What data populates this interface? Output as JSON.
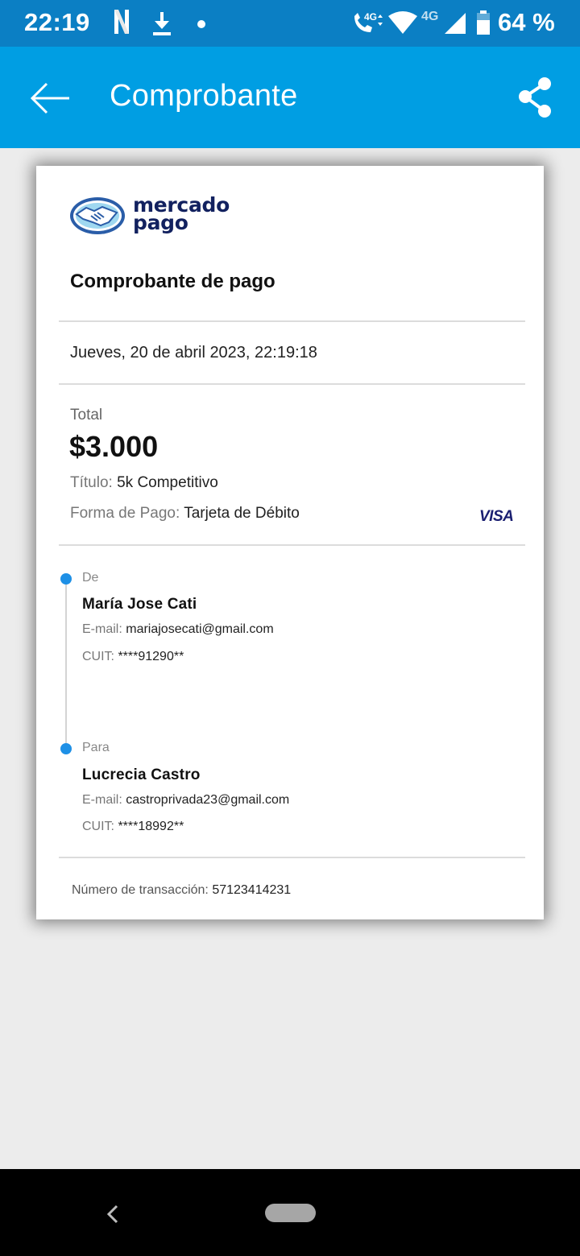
{
  "status_bar": {
    "time": "22:19",
    "network_badge": "4G",
    "battery_percent": "64 %",
    "icons": [
      "netflix-n-icon",
      "download-icon",
      "notification-dot-icon",
      "volte-call-icon",
      "wifi-icon",
      "signal-icon",
      "battery-icon"
    ]
  },
  "app_bar": {
    "title": "Comprobante",
    "icons": [
      "back-arrow-icon",
      "share-icon"
    ],
    "color": "#009ee3"
  },
  "receipt": {
    "brand": "mercado pago",
    "brand_line1": "mercado",
    "brand_line2": "pago",
    "title": "Comprobante de pago",
    "date": "Jueves, 20 de abril 2023, 22:19:18",
    "total_label": "Total",
    "total_amount": "$3.000",
    "title_key": "Título:",
    "title_value": "5k Competitivo",
    "payment_key": "Forma de Pago:",
    "payment_value": "Tarjeta de Débito",
    "card_brand": "VISA",
    "from": {
      "label": "De",
      "name": "María Jose Cati",
      "email_key": "E-mail:",
      "email": "mariajosecati@gmail.com",
      "cuit_key": "CUIT:",
      "cuit": "****91290**"
    },
    "to": {
      "label": "Para",
      "name": "Lucrecia Castro",
      "email_key": "E-mail:",
      "email": "castroprivada23@gmail.com",
      "cuit_key": "CUIT:",
      "cuit": "****18992**"
    },
    "transaction_key": "Número de transacción:",
    "transaction_number": "57123414231",
    "accent_color": "#1e90e6"
  },
  "nav_bar": {
    "icons": [
      "nav-back-icon",
      "home-pill-icon"
    ]
  }
}
